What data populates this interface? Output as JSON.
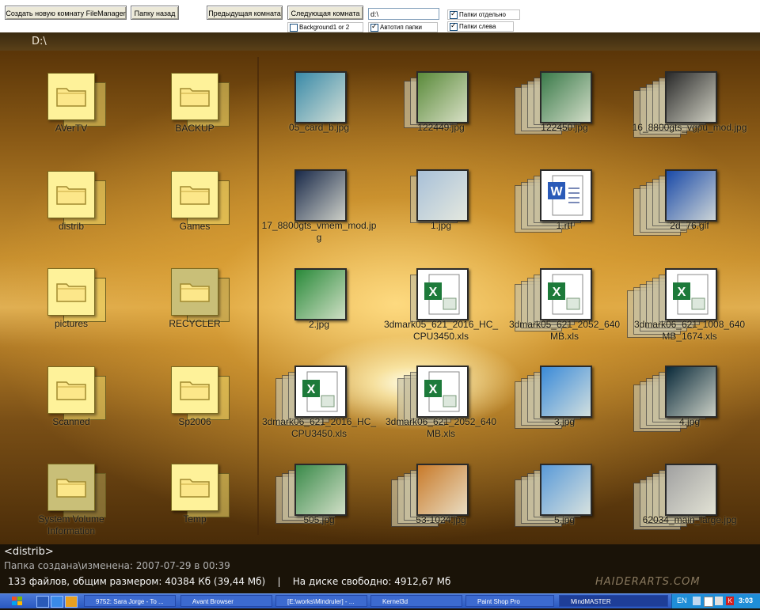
{
  "toolbar": {
    "create_room": "Создать новую комнату FileManager",
    "folder_back": "Папку назад",
    "prev_room": "Предыдущая комната",
    "next_room": "Следующая комната",
    "path_input": "d:\\",
    "bg_label": "Background1 or 2",
    "bg_checked": false,
    "autotype_label": "Автотип папки",
    "autotype_checked": true,
    "folders_sep_label": "Папки отдельно",
    "folders_sep_checked": true,
    "folders_left_label": "Папки слева",
    "folders_left_checked": true
  },
  "path": "D:\\",
  "folders": [
    {
      "name": "AVerTV",
      "dim": false
    },
    {
      "name": "BACKUP",
      "dim": false
    },
    {
      "name": "distrib",
      "dim": false
    },
    {
      "name": "Games",
      "dim": false
    },
    {
      "name": "pictures",
      "dim": false
    },
    {
      "name": "RECYCLER",
      "dim": true
    },
    {
      "name": "Scanned",
      "dim": false
    },
    {
      "name": "Sp2006",
      "dim": false
    },
    {
      "name": "System Volume Information",
      "dim": true
    },
    {
      "name": "Temp",
      "dim": false
    }
  ],
  "files": [
    {
      "name": "05_card_b.jpg",
      "kind": "img",
      "color": "#3a8aa8",
      "stack": 0
    },
    {
      "name": "122449.jpg",
      "kind": "img",
      "color": "#5a8a3a",
      "stack": 2
    },
    {
      "name": "122450.jpg",
      "kind": "img",
      "color": "#3a7a4a",
      "stack": 4
    },
    {
      "name": "16_8800gts_vgpu_mod.jpg",
      "kind": "img",
      "color": "#2a2a2a",
      "stack": 5
    },
    {
      "name": "17_8800gts_vmem_mod.jpg",
      "kind": "img",
      "color": "#1a2a4a",
      "stack": 0
    },
    {
      "name": "1.jpg",
      "kind": "img",
      "color": "#a8c0d8",
      "stack": 1
    },
    {
      "name": "1.rtf",
      "kind": "doc",
      "color": "#ffffff",
      "stack": 4
    },
    {
      "name": "2d_76.gif",
      "kind": "img",
      "color": "#1a4aa8",
      "stack": 5
    },
    {
      "name": "2.jpg",
      "kind": "img",
      "color": "#2a8a3a",
      "stack": 0
    },
    {
      "name": "3dmark05_621_2016_HC_CPU3450.xls",
      "kind": "xls",
      "color": "#ffffff",
      "stack": 1
    },
    {
      "name": "3dmark05_621_2052_640MB.xls",
      "kind": "xls",
      "color": "#ffffff",
      "stack": 4
    },
    {
      "name": "3dmark06_621_1008_640MB_1674.xls",
      "kind": "xls",
      "color": "#ffffff",
      "stack": 6
    },
    {
      "name": "3dmark06_621_2016_HC_CPU3450.xls",
      "kind": "xls",
      "color": "#ffffff",
      "stack": 3
    },
    {
      "name": "3dmark06_621_2052_640MB.xls",
      "kind": "xls",
      "color": "#ffffff",
      "stack": 3
    },
    {
      "name": "3.jpg",
      "kind": "img",
      "color": "#3a8ad8",
      "stack": 4
    },
    {
      "name": "4.jpg",
      "kind": "img",
      "color": "#0a2a3a",
      "stack": 5
    },
    {
      "name": "505.jpg",
      "kind": "img",
      "color": "#3a8a4a",
      "stack": 3
    },
    {
      "name": "53-1024.jpg",
      "kind": "img",
      "color": "#c87a2a",
      "stack": 4
    },
    {
      "name": "5.jpg",
      "kind": "img",
      "color": "#5a9ad8",
      "stack": 4
    },
    {
      "name": "62034_main_large.jpg",
      "kind": "img",
      "color": "#a0a0a0",
      "stack": 5
    }
  ],
  "status": {
    "selected": "<distrib>",
    "created": "Папка создана\\изменена: 2007-07-29 в 00:39",
    "summary": "133 файлов, общим размером: 40384 Кб (39,44 Мб)    |    На диске свободно: 4912,67 Мб",
    "watermark": "HAIDERARTS.COM"
  },
  "taskbar": {
    "tasks": [
      {
        "label": "9752: Sara Jorge - To ..."
      },
      {
        "label": "Avant Browser"
      },
      {
        "label": "[E:\\works\\Mindruler] - ..."
      },
      {
        "label": "Kernel3d"
      },
      {
        "label": "Paint Shop Pro"
      },
      {
        "label": "MindMASTER"
      }
    ],
    "lang": "EN",
    "clock": "3:03"
  }
}
